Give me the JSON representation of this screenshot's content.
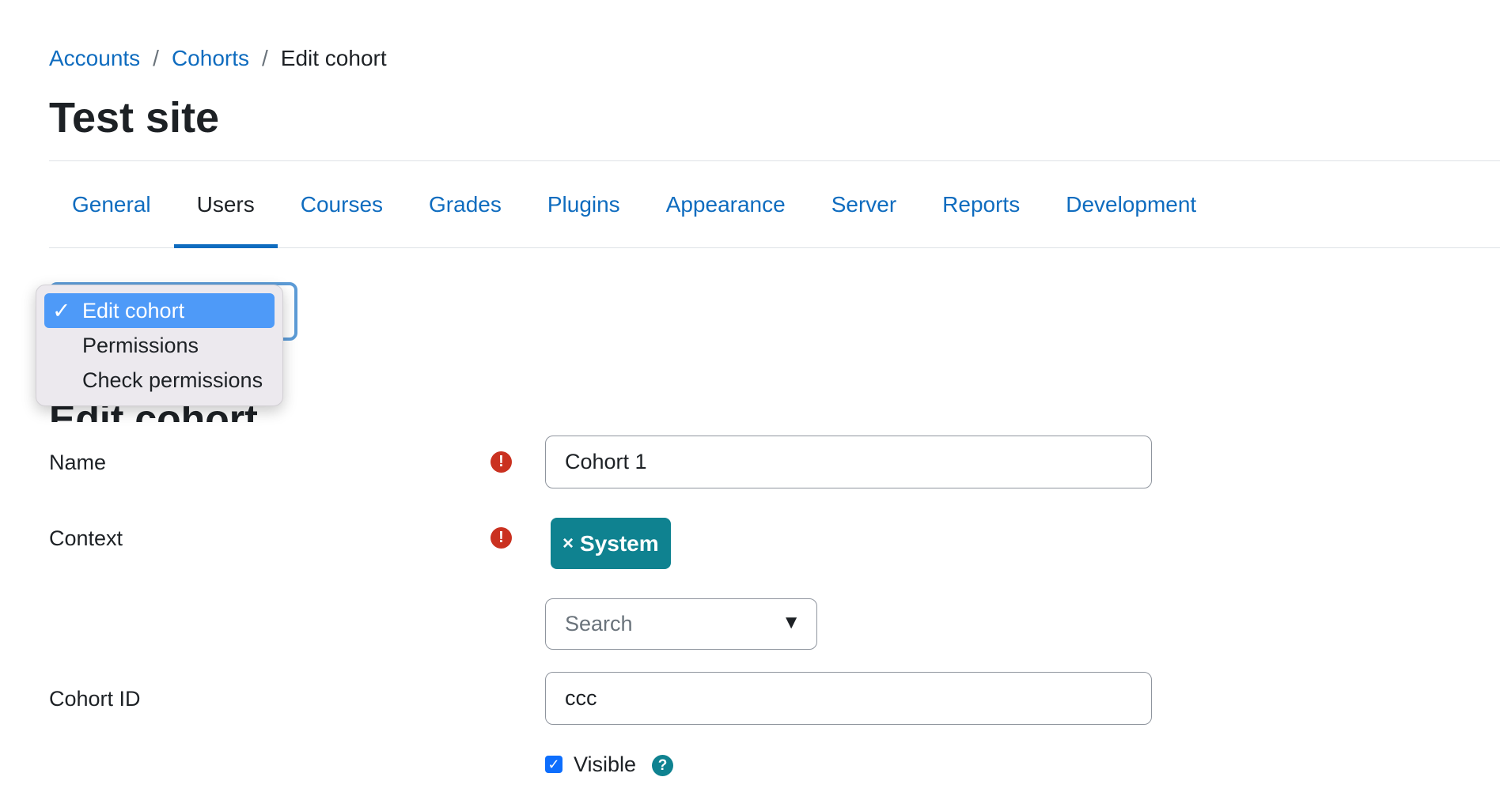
{
  "breadcrumb": {
    "items": [
      {
        "label": "Accounts"
      },
      {
        "label": "Cohorts"
      },
      {
        "label": "Edit cohort"
      }
    ],
    "separator": "/"
  },
  "page_title": "Test site",
  "tabs": [
    {
      "label": "General"
    },
    {
      "label": "Users",
      "active": true
    },
    {
      "label": "Courses"
    },
    {
      "label": "Grades"
    },
    {
      "label": "Plugins"
    },
    {
      "label": "Appearance"
    },
    {
      "label": "Server"
    },
    {
      "label": "Reports"
    },
    {
      "label": "Development"
    }
  ],
  "action_menu": {
    "options": [
      {
        "label": "Edit cohort",
        "selected": true,
        "check": "✓"
      },
      {
        "label": "Permissions"
      },
      {
        "label": "Check permissions"
      }
    ]
  },
  "section_heading": "Edit cohort",
  "form": {
    "name": {
      "label": "Name",
      "value": "Cohort 1",
      "required_icon": "!"
    },
    "context": {
      "label": "Context",
      "required_icon": "!",
      "selected_tag": "System",
      "remove_glyph": "×",
      "search_placeholder": "Search",
      "caret": "▼"
    },
    "cohort_id": {
      "label": "Cohort ID",
      "value": "ccc"
    },
    "visible": {
      "label": "Visible",
      "checked": true,
      "check_glyph": "✓",
      "help_glyph": "?"
    }
  },
  "colors": {
    "link": "#0f6cbf",
    "required": "#ca3120",
    "tag": "#0f8290",
    "dropdown_selected": "#4e9af8"
  }
}
